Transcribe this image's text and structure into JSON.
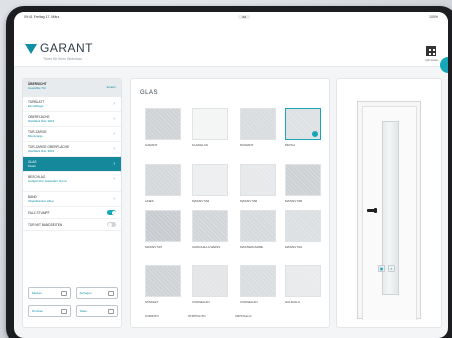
{
  "status": {
    "left": "09:41 Freitag 17. März",
    "url": "aa",
    "right": "100%"
  },
  "header": {
    "brand": "GARANT",
    "tagline": "Türen für Ihren Wohnbau",
    "qr_label": "QR-Code"
  },
  "sidebar": {
    "head": {
      "line1": "ÜBERSICHT",
      "line2": "Gewählte Tür",
      "action": "ändern"
    },
    "items": [
      {
        "line1": "TÜRBLATT",
        "line2": "Einzelflügel"
      },
      {
        "line1": "OBERFLÄCHE",
        "line2": "Weißlack RAL 9016"
      },
      {
        "line1": "TÜR-ZARGE",
        "line2": "Blockzarge"
      },
      {
        "line1": "TÜR-ZARGE OBERFLÄCHE",
        "line2": "Weißlack RAL 9016"
      },
      {
        "line1": "GLAS",
        "line2": "Petali"
      },
      {
        "line1": "BESCHLAG",
        "line2": "Griffgarnitur, Edelstahl, Rund"
      },
      {
        "line1": "BAND",
        "line2": "Objektbänder silber"
      }
    ],
    "toggles": [
      {
        "label": "FALZ STUMPF",
        "on": true
      },
      {
        "label": "TÜR MIT BANDSEITEN",
        "on": false
      }
    ],
    "buttons": [
      "Merken",
      "Anfragen",
      "Drucken",
      "Teilen"
    ]
  },
  "main": {
    "title": "GLAS",
    "swatches": [
      {
        "label": "GARANT",
        "tone": "#cfd3d6",
        "selected": false
      },
      {
        "label": "KLARGLAS",
        "tone": "#f4f5f5",
        "selected": false
      },
      {
        "label": "DIAMANT",
        "tone": "#d9dcdf",
        "selected": false
      },
      {
        "label": "PETALI",
        "tone": "#dde1e3",
        "selected": true
      },
      {
        "label": "LINES",
        "tone": "#d5d8da",
        "selected": false
      },
      {
        "label": "MASSIV 504",
        "tone": "#eceeef",
        "selected": false
      },
      {
        "label": "MASSIV 506",
        "tone": "#e6e8ea",
        "selected": false
      },
      {
        "label": "MASSIV 505",
        "tone": "#cdd1d4",
        "selected": false
      },
      {
        "label": "MASSIV 507",
        "tone": "#c8ccd0",
        "selected": false
      },
      {
        "label": "CHINCHILLA WEISS",
        "tone": "#d2d5d8",
        "selected": false
      },
      {
        "label": "MASTERCARRE",
        "tone": "#d7dadd",
        "selected": false
      },
      {
        "label": "MASSIV 501",
        "tone": "#dcdfe1",
        "selected": false
      },
      {
        "label": "STARLET",
        "tone": "#d0d3d6",
        "selected": false
      },
      {
        "label": "CORNELIAN",
        "tone": "#e3e5e7",
        "selected": false
      },
      {
        "label": "CORNELIAN",
        "tone": "#dadddf",
        "selected": false
      },
      {
        "label": "HULDIGLA",
        "tone": "#e8eaeb",
        "selected": false
      }
    ],
    "bottom_labels": [
      "CORINTO",
      "STIPPOLITO",
      "CRISTALLO"
    ]
  },
  "preview": {
    "view_icon": "image-icon",
    "zoom_icon": "zoom-icon"
  },
  "colors": {
    "accent": "#15a6b8",
    "brand": "#0f8fa3"
  }
}
